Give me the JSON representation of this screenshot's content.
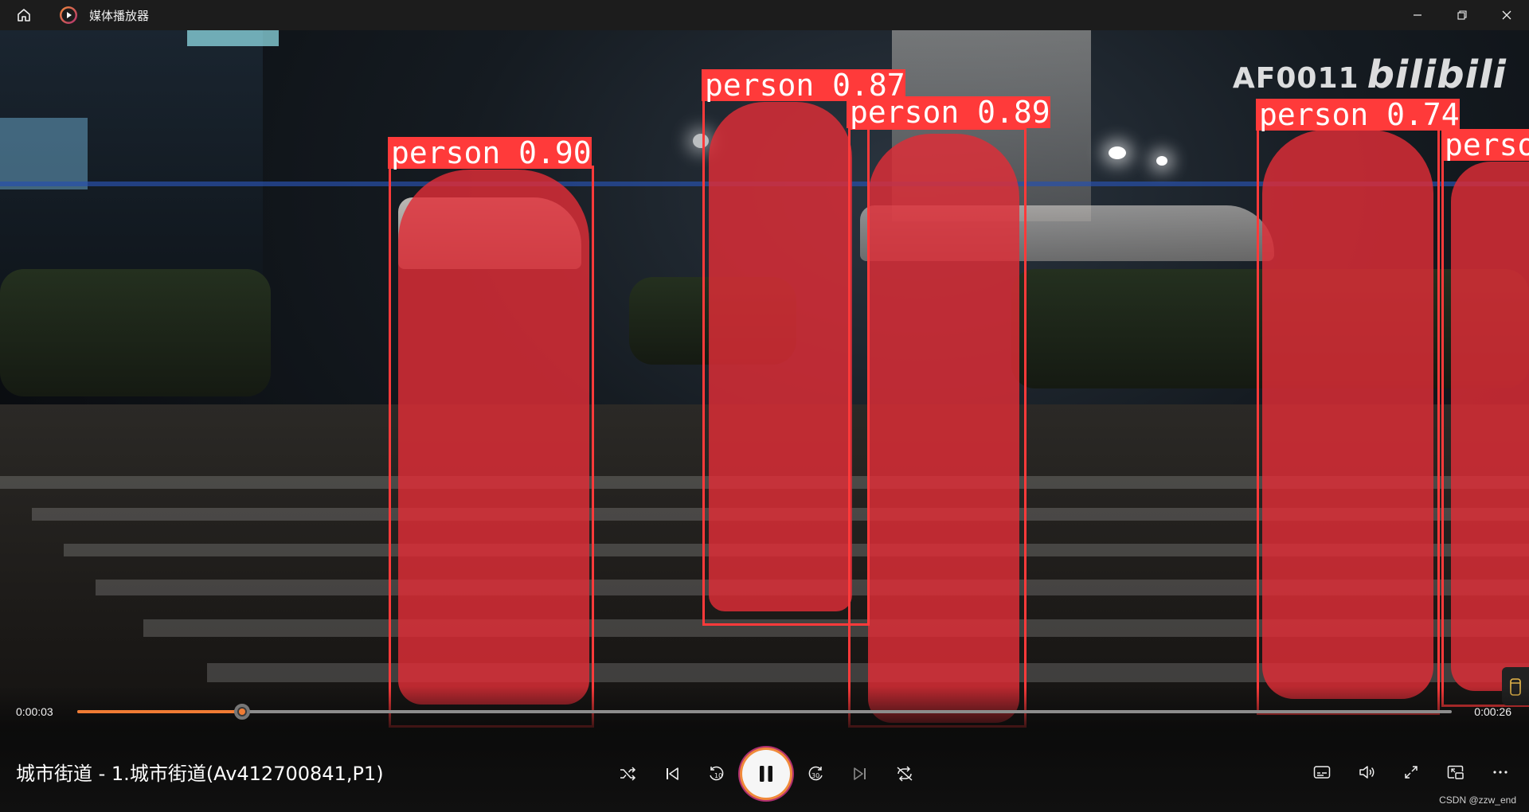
{
  "app": {
    "title": "媒体播放器"
  },
  "video": {
    "watermark_code": "AF0011",
    "watermark_brand": "bilibili",
    "detections": [
      {
        "label": "person 0.90"
      },
      {
        "label": "person 0.87"
      },
      {
        "label": "person 0.89"
      },
      {
        "label": "person 0.74"
      },
      {
        "label": "perso"
      }
    ]
  },
  "player": {
    "current_time": "0:00:03",
    "duration": "0:00:26",
    "progress": 0.12,
    "media_title": "城市街道 - 1.城市街道(Av412700841,P1)"
  },
  "footer": {
    "credit": "CSDN @zzw_end"
  },
  "colors": {
    "accent": "#f07c34",
    "bbox": "#ff3a3a",
    "mask": "#e02d37"
  }
}
